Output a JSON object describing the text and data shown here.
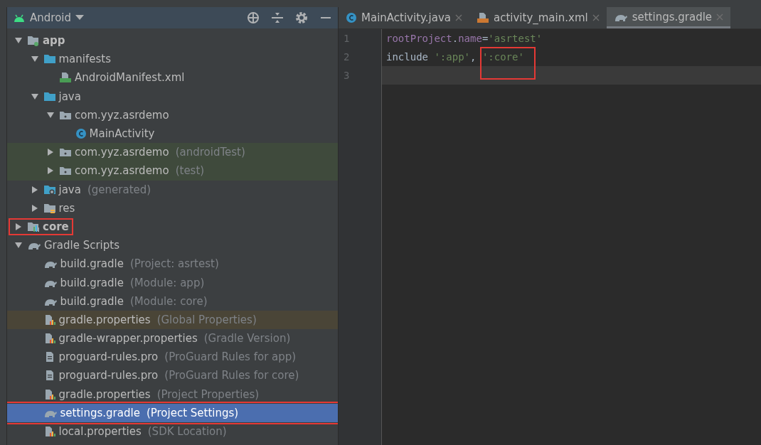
{
  "project_panel": {
    "view_selector": "Android",
    "tools": [
      {
        "kind": "locate"
      },
      {
        "kind": "collapse"
      },
      {
        "kind": "settings"
      },
      {
        "kind": "minimize"
      }
    ],
    "tree": [
      {
        "label": "app",
        "kind": "module",
        "expanded": true,
        "selected": false,
        "children": [
          {
            "label": "manifests",
            "kind": "folder",
            "expanded": true,
            "selected": false,
            "children": [
              {
                "label": "AndroidManifest.xml",
                "kind": "manifest",
                "selected": false
              }
            ]
          },
          {
            "label": "java",
            "kind": "folder",
            "expanded": true,
            "selected": false,
            "children": [
              {
                "label": "com.yyz.asrdemo",
                "kind": "package",
                "expanded": true,
                "selected": false,
                "children": [
                  {
                    "label": "MainActivity",
                    "kind": "class",
                    "selected": false
                  }
                ]
              },
              {
                "label": "com.yyz.asrdemo",
                "hint": "(androidTest)",
                "kind": "package",
                "expanded": false,
                "selected": false,
                "color": "#3f4a3c"
              },
              {
                "label": "com.yyz.asrdemo",
                "hint": "(test)",
                "kind": "package",
                "expanded": false,
                "selected": false,
                "color": "#3f4a3c"
              }
            ]
          },
          {
            "label": "java",
            "hint": "(generated)",
            "kind": "generated",
            "expanded": false,
            "selected": false
          },
          {
            "label": "res",
            "kind": "res",
            "expanded": false,
            "selected": false
          }
        ]
      },
      {
        "label": "core",
        "kind": "library",
        "expanded": false,
        "selected": false,
        "outlined": true
      },
      {
        "label": "Gradle Scripts",
        "kind": "gradle",
        "expanded": true,
        "selected": false,
        "children": [
          {
            "label": "build.gradle",
            "hint": "(Project: asrtest)",
            "kind": "gradle",
            "selected": false
          },
          {
            "label": "build.gradle",
            "hint": "(Module: app)",
            "kind": "gradle",
            "selected": false
          },
          {
            "label": "build.gradle",
            "hint": "(Module: core)",
            "kind": "gradle",
            "selected": false
          },
          {
            "label": "gradle.properties",
            "hint": "(Global Properties)",
            "kind": "properties",
            "selected": false,
            "color": "#4a4537"
          },
          {
            "label": "gradle-wrapper.properties",
            "hint": "(Gradle Version)",
            "kind": "properties",
            "selected": false
          },
          {
            "label": "proguard-rules.pro",
            "hint": "(ProGuard Rules for app)",
            "kind": "text",
            "selected": false
          },
          {
            "label": "proguard-rules.pro",
            "hint": "(ProGuard Rules for core)",
            "kind": "text",
            "selected": false
          },
          {
            "label": "gradle.properties",
            "hint": "(Project Properties)",
            "kind": "properties",
            "selected": false
          },
          {
            "label": "settings.gradle",
            "hint": "(Project Settings)",
            "kind": "gradle",
            "selected": true,
            "outlined": true
          },
          {
            "label": "local.properties",
            "hint": "(SDK Location)",
            "kind": "properties",
            "selected": false
          }
        ]
      }
    ]
  },
  "editor": {
    "tabs": [
      {
        "label": "MainActivity.java",
        "kind": "class",
        "selected": false
      },
      {
        "label": "activity_main.xml",
        "kind": "layout",
        "selected": false
      },
      {
        "label": "settings.gradle",
        "kind": "gradle",
        "selected": true
      }
    ],
    "lines": [
      {
        "number": "1",
        "current": false,
        "tokens": [
          {
            "text": "rootProject",
            "kind": "property"
          },
          {
            "text": ".",
            "kind": "plain"
          },
          {
            "text": "name",
            "kind": "property"
          },
          {
            "text": "=",
            "kind": "plain"
          },
          {
            "text": "'asrtest'",
            "kind": "string"
          }
        ]
      },
      {
        "number": "2",
        "current": false,
        "tokens": [
          {
            "text": "include ",
            "kind": "plain"
          },
          {
            "text": "':app'",
            "kind": "string"
          },
          {
            "text": ", ",
            "kind": "plain"
          },
          {
            "text": "':core'",
            "kind": "string",
            "outlined": true
          }
        ]
      },
      {
        "number": "3",
        "current": true
      }
    ]
  }
}
